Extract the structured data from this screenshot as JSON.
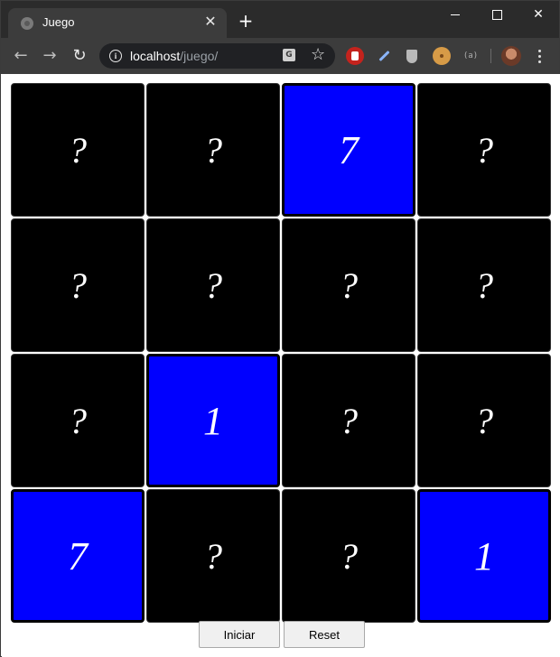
{
  "browser": {
    "tab_title": "Juego",
    "url_host": "localhost",
    "url_path": "/juego/",
    "close_tab_glyph": "✕",
    "new_tab_glyph": "+",
    "back_glyph": "←",
    "forward_glyph": "→",
    "reload_glyph": "↻",
    "star_glyph": "☆",
    "translate_glyph": "G",
    "info_glyph": "i",
    "ab_ext_label": "(a)",
    "close_window_glyph": "✕",
    "theme": {
      "titlebar": "#2b2b2b",
      "toolbar": "#3c3c3c",
      "omnibox": "#202124"
    }
  },
  "game": {
    "colors": {
      "hidden": "#000000",
      "revealed": "#0000ff",
      "text": "#ffffff"
    },
    "cards": [
      {
        "label": "?",
        "revealed": false
      },
      {
        "label": "?",
        "revealed": false
      },
      {
        "label": "7",
        "revealed": true
      },
      {
        "label": "?",
        "revealed": false
      },
      {
        "label": "?",
        "revealed": false
      },
      {
        "label": "?",
        "revealed": false
      },
      {
        "label": "?",
        "revealed": false
      },
      {
        "label": "?",
        "revealed": false
      },
      {
        "label": "?",
        "revealed": false
      },
      {
        "label": "1",
        "revealed": true
      },
      {
        "label": "?",
        "revealed": false
      },
      {
        "label": "?",
        "revealed": false
      },
      {
        "label": "7",
        "revealed": true
      },
      {
        "label": "?",
        "revealed": false
      },
      {
        "label": "?",
        "revealed": false
      },
      {
        "label": "1",
        "revealed": true
      }
    ],
    "buttons": {
      "start_label": "Iniciar",
      "reset_label": "Reset"
    }
  }
}
